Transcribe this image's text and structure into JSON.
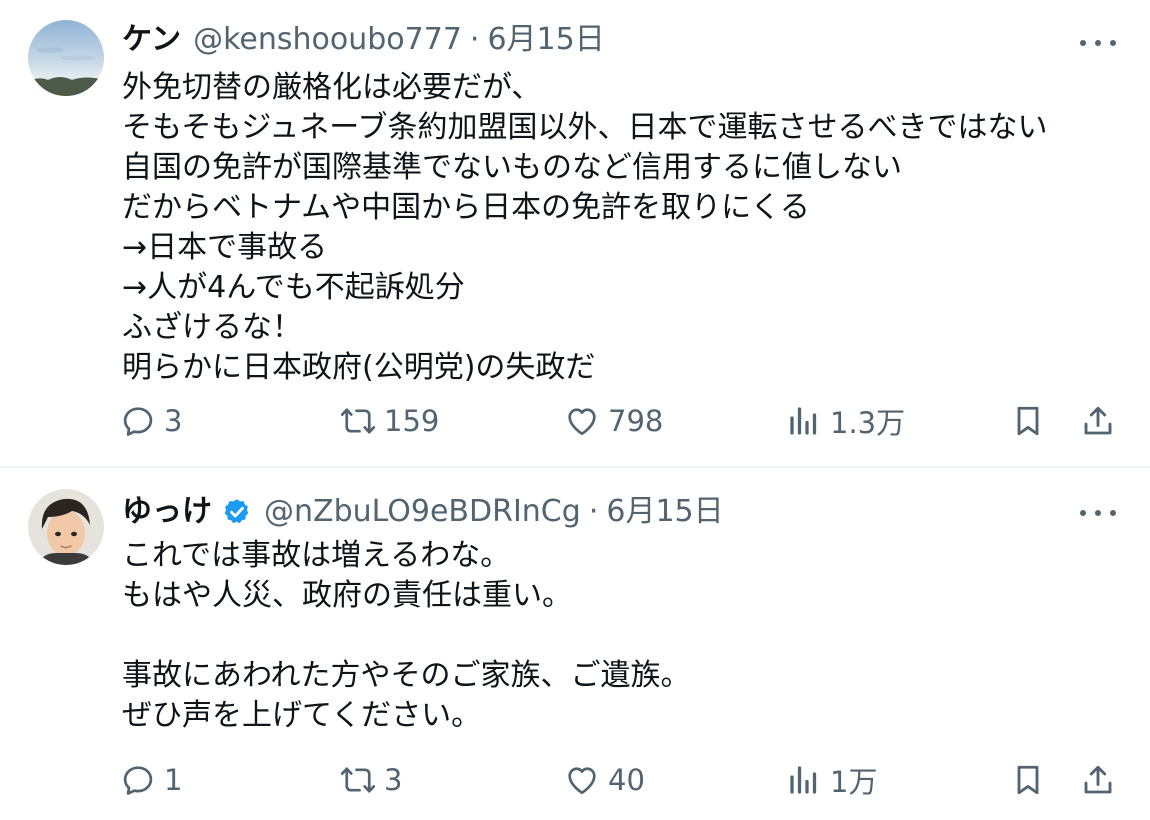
{
  "posts": [
    {
      "author_name": "ケン",
      "handle": "@kenshooubo777",
      "separator": "·",
      "date": "6月15日",
      "verified": false,
      "lines": [
        "外免切替の厳格化は必要だが、",
        "そもそもジュネーブ条約加盟国以外、日本で運転させるべきではない",
        "自国の免許が国際基準でないものなど信用するに値しない",
        "だからベトナムや中国から日本の免許を取りにくる",
        "→日本で事故る",
        "→人が4んでも不起訴処分",
        "ふざけるな！",
        "明らかに日本政府(公明党)の失政だ"
      ],
      "metrics": {
        "replies": "3",
        "reposts": "159",
        "likes": "798",
        "views": "1.3万"
      }
    },
    {
      "author_name": "ゆっけ",
      "handle": "@nZbuLO9eBDRInCg",
      "separator": "·",
      "date": "6月15日",
      "verified": true,
      "lines": [
        "これでは事故は増えるわな。",
        "もはや人災、政府の責任は重い。",
        "",
        "事故にあわれた方やそのご家族、ご遺族。",
        "ぜひ声を上げてください。"
      ],
      "metrics": {
        "replies": "1",
        "reposts": "3",
        "likes": "40",
        "views": "1万"
      }
    }
  ],
  "icons": {
    "reply": "reply-icon",
    "repost": "repost-icon",
    "like": "heart-icon",
    "views": "views-icon",
    "bookmark": "bookmark-icon",
    "share": "share-icon",
    "more": "more-icon",
    "verified": "verified-badge-icon"
  },
  "colors": {
    "text": "#0f1419",
    "secondary": "#536471",
    "verified": "#1d9bf0",
    "divider": "#eff3f4"
  }
}
